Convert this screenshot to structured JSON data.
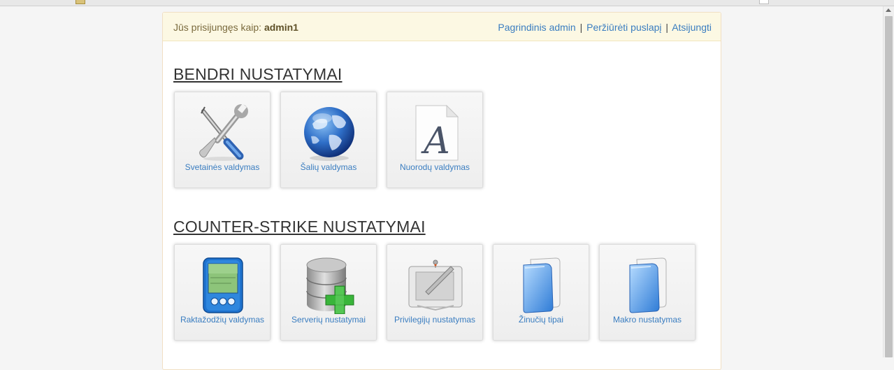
{
  "header": {
    "login_prefix": "Jūs prisijungęs kaip:",
    "username": "admin1",
    "links": [
      {
        "label": "Pagrindinis admin"
      },
      {
        "label": "Peržiūrėti puslapį"
      },
      {
        "label": "Atsijungti"
      }
    ],
    "separator": "|"
  },
  "sections": [
    {
      "title": "BENDRI NUSTATYMAI",
      "tiles": [
        {
          "label": "Svetainės valdymas",
          "icon": "tools-icon"
        },
        {
          "label": "Šalių valdymas",
          "icon": "globe-icon"
        },
        {
          "label": "Nuorodų valdymas",
          "icon": "font-document-icon"
        }
      ]
    },
    {
      "title": "COUNTER-STRIKE NUSTATYMAI",
      "tiles": [
        {
          "label": "Raktažodžių valdymas",
          "icon": "pda-icon"
        },
        {
          "label": "Serverių nustatymai",
          "icon": "database-add-icon"
        },
        {
          "label": "Privilegijų nustatymas",
          "icon": "drawing-tablet-icon"
        },
        {
          "label": "Žinučių tipai",
          "icon": "blue-folder-icon"
        },
        {
          "label": "Makro nustatymas",
          "icon": "blue-folder-icon"
        }
      ]
    }
  ],
  "colors": {
    "link": "#3a7dc0",
    "header_background": "#fcf8e3",
    "page_background": "#f5f5f5"
  }
}
